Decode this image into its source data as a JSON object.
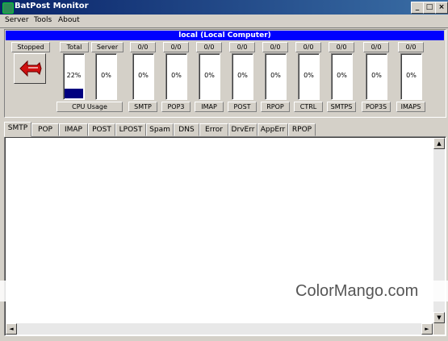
{
  "window": {
    "title": "BatPost Monitor",
    "minimize": "_",
    "maximize": "□",
    "close": "×"
  },
  "menu": [
    "Server",
    "Tools",
    "About"
  ],
  "server_bar": "local (Local Computer)",
  "status": {
    "label": "Stopped"
  },
  "cpu": {
    "headers": [
      "Total",
      "Server"
    ],
    "values": [
      "22%",
      "0%"
    ],
    "total_fraction": 0.22,
    "footer": "CPU Usage"
  },
  "gauges": [
    {
      "header": "0/0",
      "value": "0%",
      "label": "SMTP"
    },
    {
      "header": "0/0",
      "value": "0%",
      "label": "POP3"
    },
    {
      "header": "0/0",
      "value": "0%",
      "label": "IMAP"
    },
    {
      "header": "0/0",
      "value": "0%",
      "label": "POST"
    },
    {
      "header": "0/0",
      "value": "0%",
      "label": "RPOP"
    },
    {
      "header": "0/0",
      "value": "0%",
      "label": "CTRL"
    },
    {
      "header": "0/0",
      "value": "0%",
      "label": "SMTPS"
    },
    {
      "header": "0/0",
      "value": "0%",
      "label": "POP3S"
    },
    {
      "header": "0/0",
      "value": "0%",
      "label": "IMAPS"
    }
  ],
  "tabs": [
    "SMTP",
    "POP",
    "IMAP",
    "POST",
    "LPOST",
    "Spam",
    "DNS",
    "Error",
    "DrvErr",
    "AppErr",
    "RPOP"
  ],
  "active_tab": "SMTP",
  "watermark": "ColorMango.com"
}
